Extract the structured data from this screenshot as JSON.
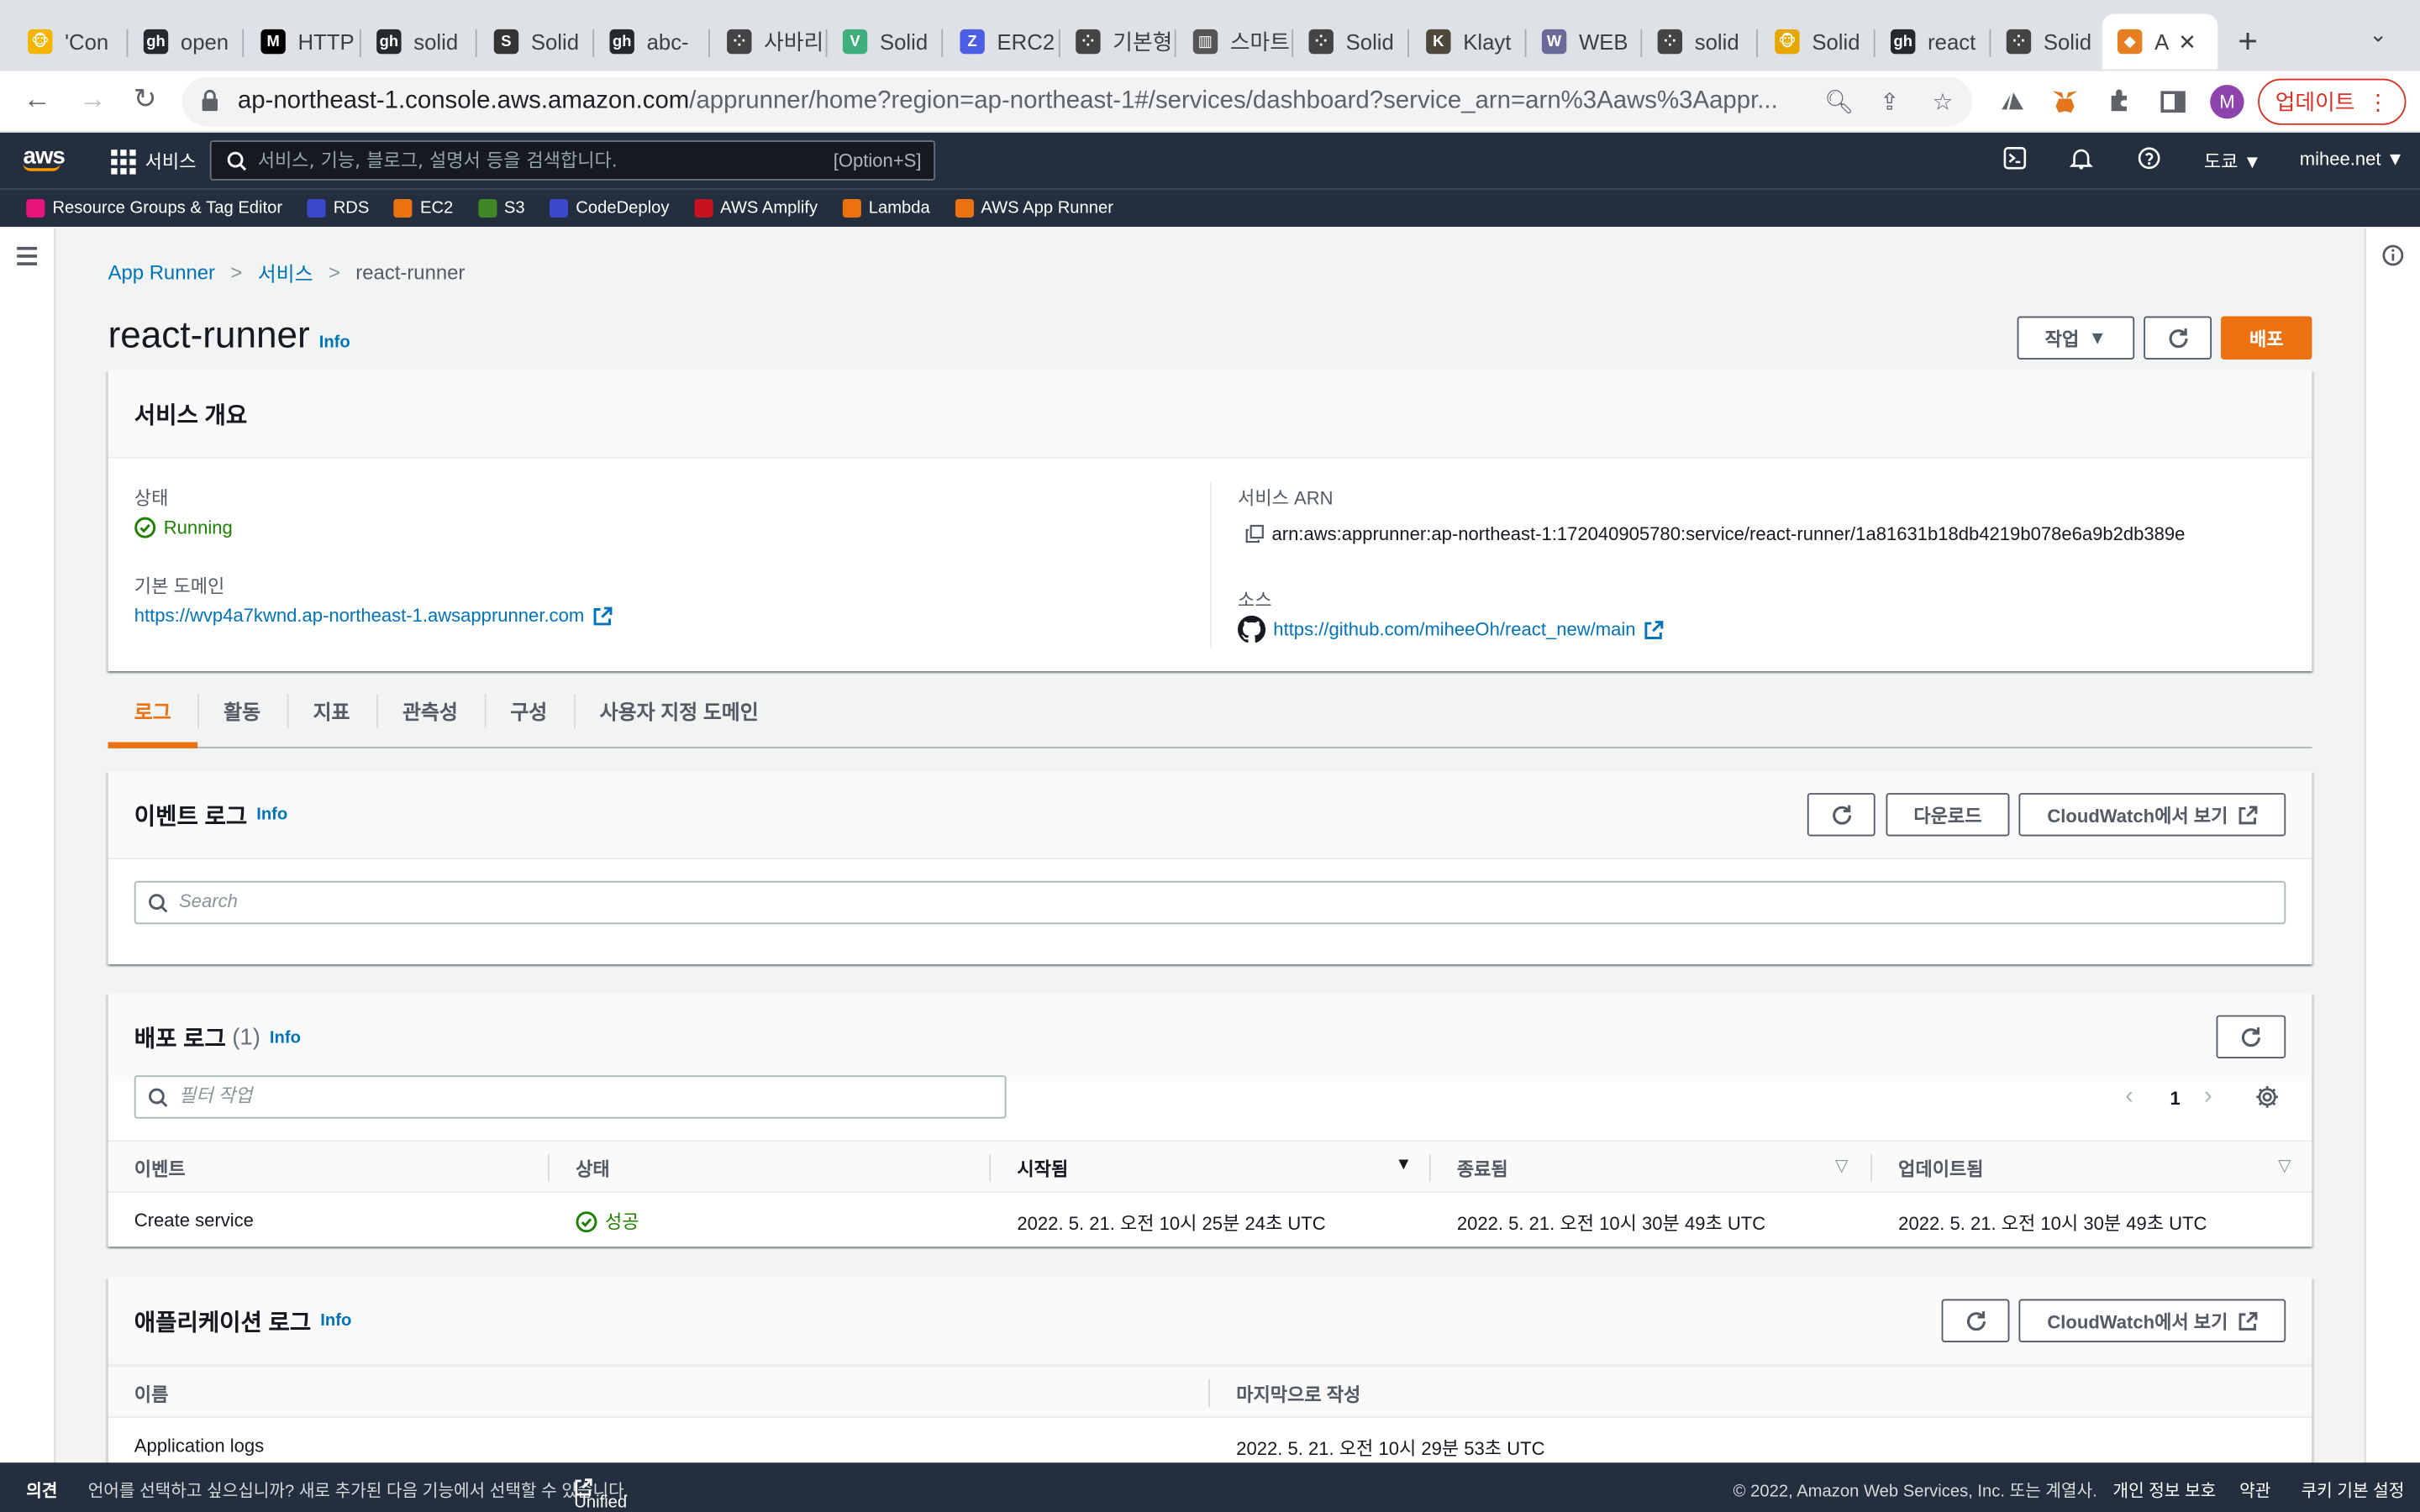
{
  "browser": {
    "tabs": [
      {
        "label": "'Con",
        "color": "#f4b400",
        "glyph": "🐵"
      },
      {
        "label": "open",
        "color": "#24292e",
        "glyph": "gh"
      },
      {
        "label": "HTTP",
        "color": "#000000",
        "glyph": "M"
      },
      {
        "label": "solid",
        "color": "#24292e",
        "glyph": "gh"
      },
      {
        "label": "Solid",
        "color": "#333333",
        "glyph": "S"
      },
      {
        "label": "abc-",
        "color": "#24292e",
        "glyph": "gh"
      },
      {
        "label": "사바리",
        "color": "#444444",
        "glyph": "⁘"
      },
      {
        "label": "Solid",
        "color": "#3eaf7c",
        "glyph": "V"
      },
      {
        "label": "ERC2",
        "color": "#4e5ee4",
        "glyph": "Z"
      },
      {
        "label": "기본형",
        "color": "#444444",
        "glyph": "⁘"
      },
      {
        "label": "스마트",
        "color": "#555555",
        "glyph": "▥"
      },
      {
        "label": "Solid",
        "color": "#444444",
        "glyph": "⁘"
      },
      {
        "label": "Klayt",
        "color": "#4f473b",
        "glyph": "K"
      },
      {
        "label": "WEB",
        "color": "#6b6b9a",
        "glyph": "W"
      },
      {
        "label": "solid",
        "color": "#444444",
        "glyph": "⁘"
      },
      {
        "label": "Solid",
        "color": "#e6a700",
        "glyph": "🐵"
      },
      {
        "label": "react",
        "color": "#24292e",
        "glyph": "gh"
      },
      {
        "label": "Solid",
        "color": "#444444",
        "glyph": "⁘"
      },
      {
        "label": "A",
        "color": "#e67e22",
        "glyph": "◆"
      }
    ],
    "url_host": "ap-northeast-1.console.aws.amazon.com",
    "url_path": "/apprunner/home?region=ap-northeast-1#/services/dashboard?service_arn=arn%3Aaws%3Aappr...",
    "avatar_letter": "M",
    "update_label": "업데이트"
  },
  "awsnav": {
    "logo": "aws",
    "services_label": "서비스",
    "search_placeholder": "서비스, 기능, 블로그, 설명서 등을 검색합니다.",
    "search_shortcut": "[Option+S]",
    "region": "도쿄 ▼",
    "account": "mihee.net ▼"
  },
  "favorites": [
    {
      "label": "Resource Groups & Tag Editor",
      "color": "#e7157b"
    },
    {
      "label": "RDS",
      "color": "#3b48cc"
    },
    {
      "label": "EC2",
      "color": "#ec7211"
    },
    {
      "label": "S3",
      "color": "#3f8624"
    },
    {
      "label": "CodeDeploy",
      "color": "#3b48cc"
    },
    {
      "label": "AWS Amplify",
      "color": "#c7131f"
    },
    {
      "label": "Lambda",
      "color": "#ec7211"
    },
    {
      "label": "AWS App Runner",
      "color": "#ec7211"
    }
  ],
  "breadcrumb": {
    "root": "App Runner",
    "section": "서비스",
    "current": "react-runner"
  },
  "page": {
    "title": "react-runner",
    "info": "Info",
    "actions_label": "작업",
    "deploy_label": "배포"
  },
  "overview": {
    "title": "서비스 개요",
    "status_label": "상태",
    "status_value": "Running",
    "domain_label": "기본 도메인",
    "domain_value": "https://wvp4a7kwnd.ap-northeast-1.awsapprunner.com",
    "arn_label": "서비스 ARN",
    "arn_value": "arn:aws:apprunner:ap-northeast-1:172040905780:service/react-runner/1a81631b18db4219b078e6a9b2db389e",
    "source_label": "소스",
    "source_value": "https://github.com/miheeOh/react_new/main",
    "status_color": "#1d8102"
  },
  "tabs": [
    "로그",
    "활동",
    "지표",
    "관측성",
    "구성",
    "사용자 지정 도메인"
  ],
  "event_log": {
    "title": "이벤트 로그",
    "info": "Info",
    "download_label": "다운로드",
    "cloudwatch_label": "CloudWatch에서 보기",
    "search_placeholder": "Search"
  },
  "deploy_log": {
    "title": "배포 로그",
    "count": "(1)",
    "info": "Info",
    "filter_placeholder": "필터 작업",
    "page_number": "1",
    "columns": [
      "이벤트",
      "상태",
      "시작됨",
      "종료됨",
      "업데이트됨"
    ],
    "rows": [
      {
        "event": "Create service",
        "status": "성공",
        "started": "2022. 5. 21. 오전 10시 25분 24초 UTC",
        "ended": "2022. 5. 21. 오전 10시 30분 49초 UTC",
        "updated": "2022. 5. 21. 오전 10시 30분 49초 UTC"
      }
    ]
  },
  "app_log": {
    "title": "애플리케이션 로그",
    "info": "Info",
    "cloudwatch_label": "CloudWatch에서 보기",
    "columns": [
      "이름",
      "마지막으로 작성"
    ],
    "rows": [
      {
        "name": "Application logs",
        "last_written": "2022. 5. 21. 오전 10시 29분 53초 UTC"
      }
    ]
  },
  "footer": {
    "feedback": "의견",
    "language_prompt": "언어를 선택하고 싶으십니까? 새로 추가된 다음 기능에서 선택할 수 있습니다.",
    "unified_settings": "Unified Settings",
    "copyright": "© 2022, Amazon Web Services, Inc. 또는 계열사.",
    "privacy": "개인 정보 보호",
    "terms": "약관",
    "cookies": "쿠키 기본 설정"
  }
}
